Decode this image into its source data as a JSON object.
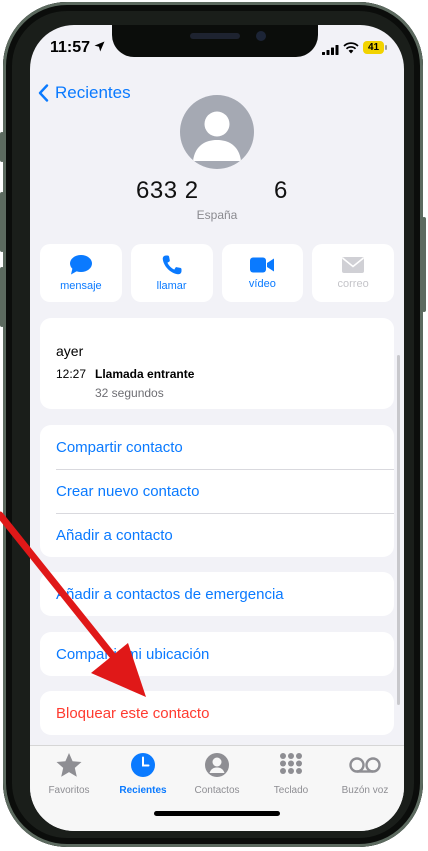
{
  "status_bar": {
    "time": "11:57",
    "battery": "41",
    "location_icon": "location-arrow-icon",
    "signal_icon": "cellular-signal-icon",
    "wifi_icon": "wifi-icon"
  },
  "nav": {
    "back_label": "Recientes"
  },
  "contact": {
    "number_part1": "633 2",
    "number_part2": "6",
    "country": "España"
  },
  "actions": [
    {
      "label": "mensaje",
      "icon": "message-bubble-icon",
      "enabled": true
    },
    {
      "label": "llamar",
      "icon": "phone-icon",
      "enabled": true
    },
    {
      "label": "vídeo",
      "icon": "video-camera-icon",
      "enabled": true
    },
    {
      "label": "correo",
      "icon": "mail-envelope-icon",
      "enabled": false
    }
  ],
  "recent_call": {
    "day": "ayer",
    "time": "12:27",
    "type": "Llamada entrante",
    "duration": "32 segundos"
  },
  "options": {
    "share": "Compartir contacto",
    "new_contact": "Crear nuevo contacto",
    "add_to_contact": "Añadir a contacto",
    "emergency": "Añadir a contactos de emergencia",
    "share_location": "Compartir mi ubicación",
    "block": "Bloquear este contacto"
  },
  "tabs": [
    {
      "label": "Favoritos",
      "icon": "star-icon",
      "active": false
    },
    {
      "label": "Recientes",
      "icon": "clock-icon",
      "active": true
    },
    {
      "label": "Contactos",
      "icon": "person-circle-icon",
      "active": false
    },
    {
      "label": "Teclado",
      "icon": "keypad-icon",
      "active": false
    },
    {
      "label": "Buzón voz",
      "icon": "voicemail-icon",
      "active": false
    }
  ],
  "colors": {
    "accent": "#0a7aff",
    "destructive": "#ff3b30",
    "annotation_arrow": "#e01818"
  }
}
